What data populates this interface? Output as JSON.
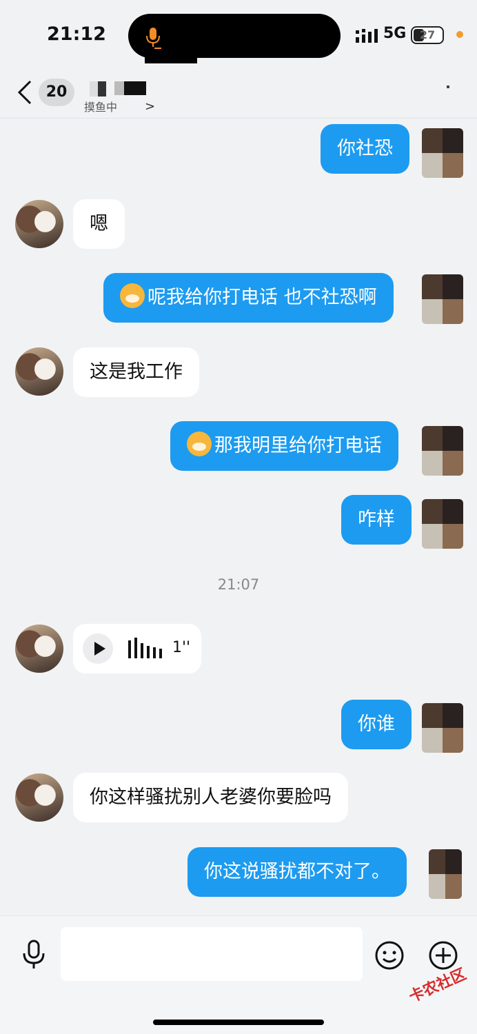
{
  "status_bar": {
    "time": "21:12",
    "network": "5G",
    "battery": "27"
  },
  "header": {
    "unread_count": "20",
    "subtitle": "摸鱼中",
    "chevron": ">"
  },
  "messages": [
    {
      "side": "out",
      "text": "你社恐"
    },
    {
      "side": "in",
      "text": "嗯"
    },
    {
      "side": "out",
      "text": "呢我给你打电话 也不社恐啊",
      "emoji": "cat-face-emoji"
    },
    {
      "side": "in",
      "text": "这是我工作"
    },
    {
      "side": "out",
      "text": "那我明里给你打电话",
      "emoji": "cat-face-emoji"
    },
    {
      "side": "out",
      "text": "咋样"
    },
    {
      "side": "in",
      "text": "你这样骚扰别人老婆你要脸吗"
    },
    {
      "side": "out",
      "text": "你谁"
    },
    {
      "side": "out",
      "text": "你这说骚扰都不对了。"
    }
  ],
  "timestamp": "21:07",
  "voice_message": {
    "duration": "1''"
  },
  "input": {
    "placeholder": ""
  },
  "watermark": "卡农社区",
  "colors": {
    "accent": "#1d9bf0",
    "background": "#f1f2f4"
  }
}
